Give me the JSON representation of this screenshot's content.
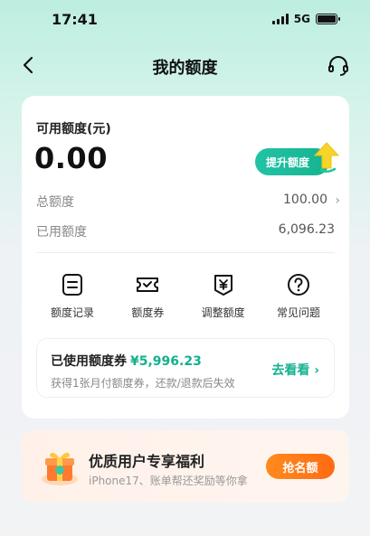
{
  "status_bar": {
    "time": "17:41",
    "network": "5G"
  },
  "header": {
    "title": "我的额度",
    "back_icon": "chevron-left-icon",
    "service_icon": "headset-icon"
  },
  "credit": {
    "available_label": "可用额度(元)",
    "available_amount": "0.00",
    "raise_button": "提升额度",
    "total_label": "总额度",
    "total_value": "100.00",
    "used_label": "已用额度",
    "used_value": "6,096.23"
  },
  "shortcuts": [
    {
      "label": "额度记录",
      "icon": "record-icon"
    },
    {
      "label": "额度券",
      "icon": "coupon-icon"
    },
    {
      "label": "调整额度",
      "icon": "yen-adjust-icon"
    },
    {
      "label": "常见问题",
      "icon": "question-icon"
    }
  ],
  "coupon": {
    "title": "已使用额度券",
    "amount": "¥5,996.23",
    "description": "获得1张月付额度券，还款/退款后失效",
    "link": "去看看 ›"
  },
  "promo": {
    "title": "优质用户专享福利",
    "description": "iPhone17、账单帮还奖励等你拿",
    "button": "抢名额"
  },
  "colors": {
    "accent": "#13b08e",
    "promo_button": "#ff7a18"
  }
}
